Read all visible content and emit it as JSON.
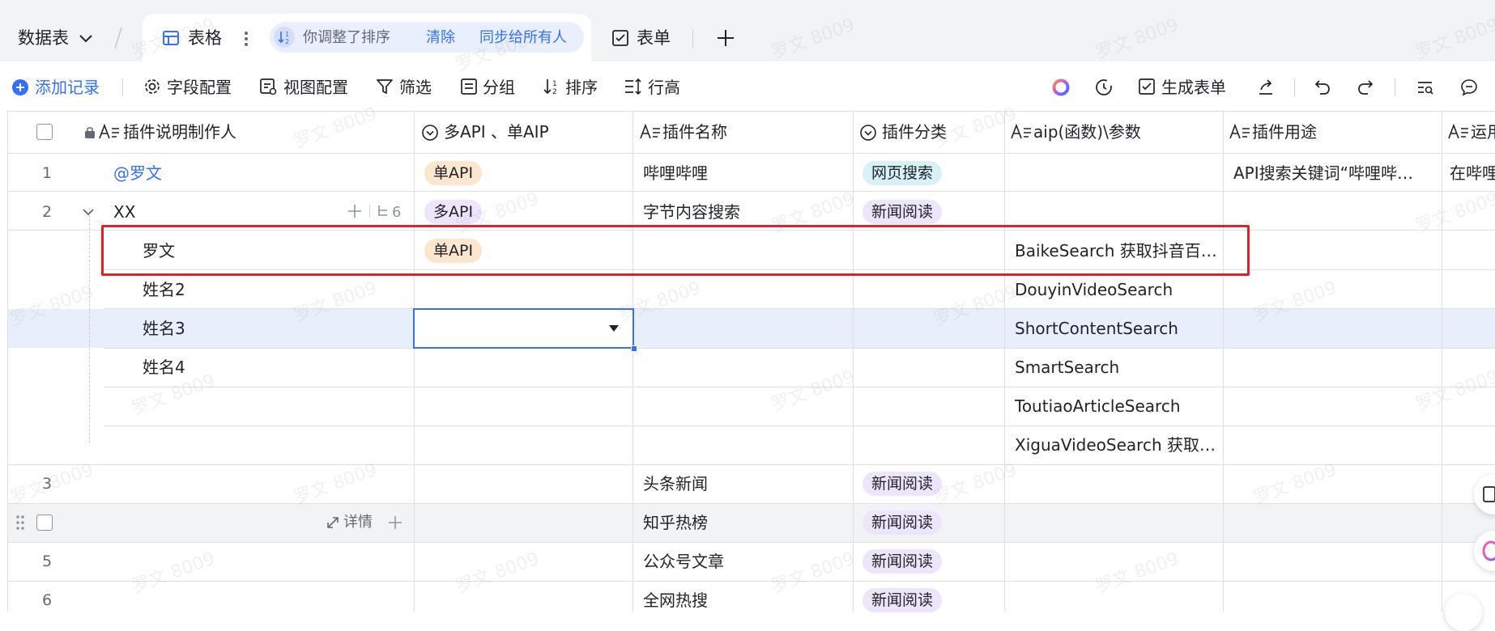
{
  "tabs": {
    "datatable_label": "数据表",
    "grid_label": "表格",
    "sort_notice": "你调整了排序",
    "clear_label": "清除",
    "sync_label": "同步给所有人",
    "form_label": "表单"
  },
  "toolbar": {
    "add_record": "添加记录",
    "field_config": "字段配置",
    "view_config": "视图配置",
    "filter": "筛选",
    "group": "分组",
    "sort": "排序",
    "row_height": "行高",
    "generate_form": "生成表单"
  },
  "columns": [
    {
      "label": "插件说明制作人",
      "type_icon": "text-icon"
    },
    {
      "label": "多API 、单AIP",
      "type_icon": "select-icon"
    },
    {
      "label": "插件名称",
      "type_icon": "text-icon"
    },
    {
      "label": "插件分类",
      "type_icon": "select-icon"
    },
    {
      "label": "aip(函数)\\参数",
      "type_icon": "text-icon"
    },
    {
      "label": "插件用途",
      "type_icon": "text-icon"
    },
    {
      "label": "运用",
      "type_icon": "text-icon"
    }
  ],
  "rows": {
    "r1": {
      "num": "1",
      "author": "@罗文",
      "api": "单API",
      "name": "哔哩哔哩",
      "category": "网页搜索",
      "usage": "API搜索关键词“哔哩哔…",
      "apply": "在哔哩"
    },
    "r2": {
      "num": "2",
      "author": "XX",
      "sub_count": "6",
      "api": "多API",
      "name": "字节内容搜索",
      "category": "新闻阅读"
    },
    "s1": {
      "author": "罗文",
      "api": "单API",
      "func": "BaikeSearch 获取抖音百…"
    },
    "s2": {
      "author": "姓名2",
      "func": "DouyinVideoSearch"
    },
    "s3": {
      "author": "姓名3",
      "func": "ShortContentSearch"
    },
    "s4": {
      "author": "姓名4",
      "func": "SmartSearch"
    },
    "s5": {
      "func": "ToutiaoArticleSearch"
    },
    "s6": {
      "func": "XiguaVideoSearch 获取…"
    },
    "r3": {
      "num": "3",
      "name": "头条新闻",
      "category": "新闻阅读"
    },
    "r4": {
      "detail": "详情",
      "name": "知乎热榜",
      "category": "新闻阅读"
    },
    "r5": {
      "num": "5",
      "name": "公众号文章",
      "category": "新闻阅读"
    },
    "r6": {
      "num": "6",
      "name": "全网热搜",
      "category": "新闻阅读"
    }
  },
  "watermark": "罗文 8009",
  "colors": {
    "accent": "#3370ff",
    "highlight_row": "#e8eefc",
    "annotation_box": "#e0202a",
    "tag_orange": "#fce6cd",
    "tag_purple": "#ece5fb",
    "tag_cyan": "#d7f1f6",
    "hover_row": "#f2f3f5"
  }
}
